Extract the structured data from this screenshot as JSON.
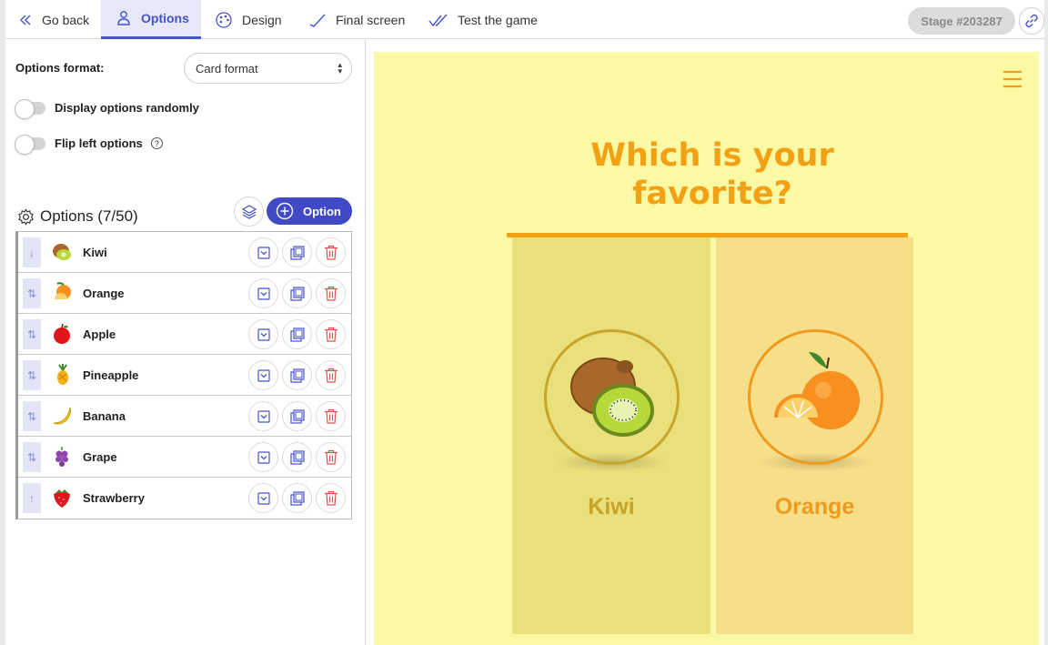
{
  "nav": {
    "items": [
      {
        "label": "Go back",
        "icon": "chevrons-left-icon"
      },
      {
        "label": "Options",
        "icon": "person-icon",
        "active": true
      },
      {
        "label": "Design",
        "icon": "palette-icon"
      },
      {
        "label": "Final screen",
        "icon": "check-icon"
      },
      {
        "label": "Test the game",
        "icon": "double-check-icon"
      }
    ],
    "stage": "Stage #203287",
    "link_icon": "link-icon"
  },
  "settings": {
    "format_label": "Options format:",
    "format_value": "Card format",
    "toggle_random": "Display options randomly",
    "toggle_flip": "Flip left options",
    "help_icon": "?"
  },
  "options": {
    "header": "Options (7/50)",
    "add_label": "Option",
    "items": [
      {
        "label": "Kiwi",
        "arrow": "↓",
        "icon": "kiwi-icon"
      },
      {
        "label": "Orange",
        "arrow": "⇅",
        "icon": "orange-icon"
      },
      {
        "label": "Apple",
        "arrow": "⇅",
        "icon": "apple-icon"
      },
      {
        "label": "Pineapple",
        "arrow": "⇅",
        "icon": "pineapple-icon"
      },
      {
        "label": "Banana",
        "arrow": "⇅",
        "icon": "banana-icon"
      },
      {
        "label": "Grape",
        "arrow": "⇅",
        "icon": "grape-icon"
      },
      {
        "label": "Strawberry",
        "arrow": "↑",
        "icon": "strawberry-icon"
      }
    ]
  },
  "preview": {
    "title_line1": "Which is your",
    "title_line2": "favorite?",
    "cards": [
      {
        "label": "Kiwi",
        "color": "#e9e07c"
      },
      {
        "label": "Orange",
        "color": "#f7df89"
      }
    ],
    "accent": "#f2a114",
    "background": "#fcf9a5"
  },
  "colors": {
    "primary": "#4149c6",
    "delete": "#d9534f"
  }
}
